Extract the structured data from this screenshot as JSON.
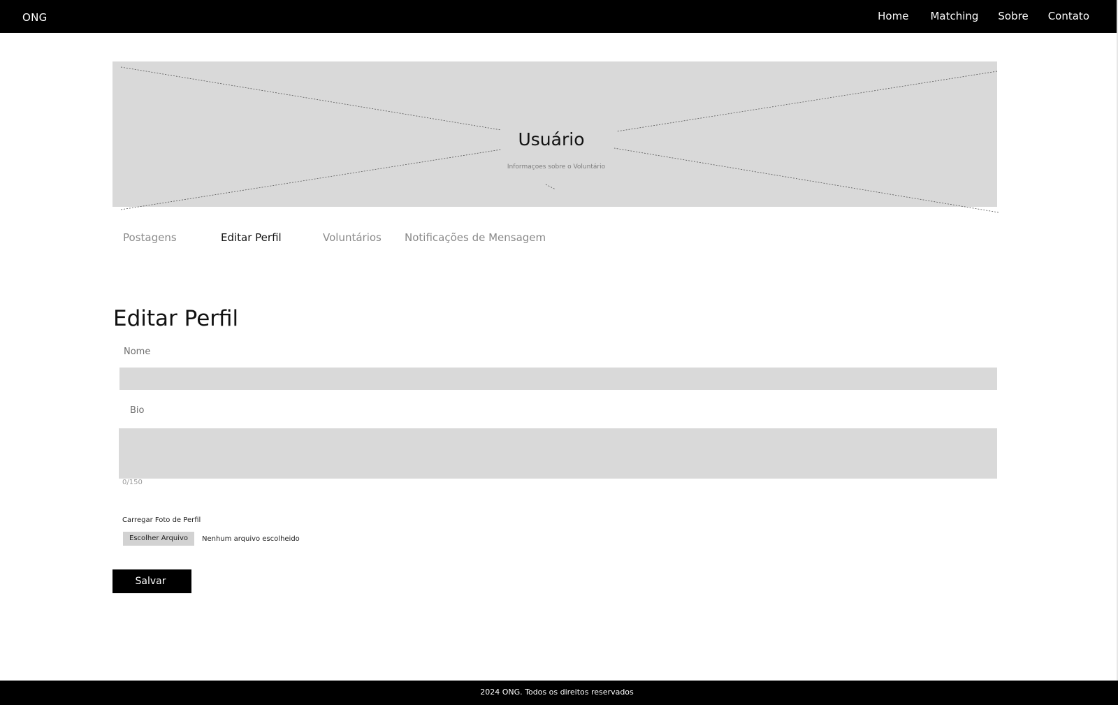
{
  "header": {
    "brand": "ONG",
    "nav": [
      {
        "label": "Home"
      },
      {
        "label": "Matching"
      },
      {
        "label": "Sobre"
      },
      {
        "label": "Contato"
      }
    ]
  },
  "hero": {
    "title": "Usuário",
    "subtitle": "Informaçoes sobre o Voluntário"
  },
  "tabs": [
    {
      "label": "Postagens",
      "active": false
    },
    {
      "label": "Editar Perfil",
      "active": true
    },
    {
      "label": "Voluntários",
      "active": false
    },
    {
      "label": "Notificações de Mensagem",
      "active": false
    }
  ],
  "form": {
    "title": "Editar Perfil",
    "name_label": "Nome",
    "name_value": "",
    "bio_label": "Bio",
    "bio_value": "",
    "bio_counter": "0/150",
    "upload_label": "Carregar Foto de Perfil",
    "file_button": "Escolher Arquivo",
    "file_status": "Nenhum arquivo escolheido",
    "save_label": "Salvar"
  },
  "footer": {
    "text": "2024 ONG. Todos os direitos reservados"
  },
  "colors": {
    "bar": "#000000",
    "placeholder": "#d9d9d9",
    "active_tab": "#111111",
    "inactive_tab": "#8a8a8a"
  }
}
